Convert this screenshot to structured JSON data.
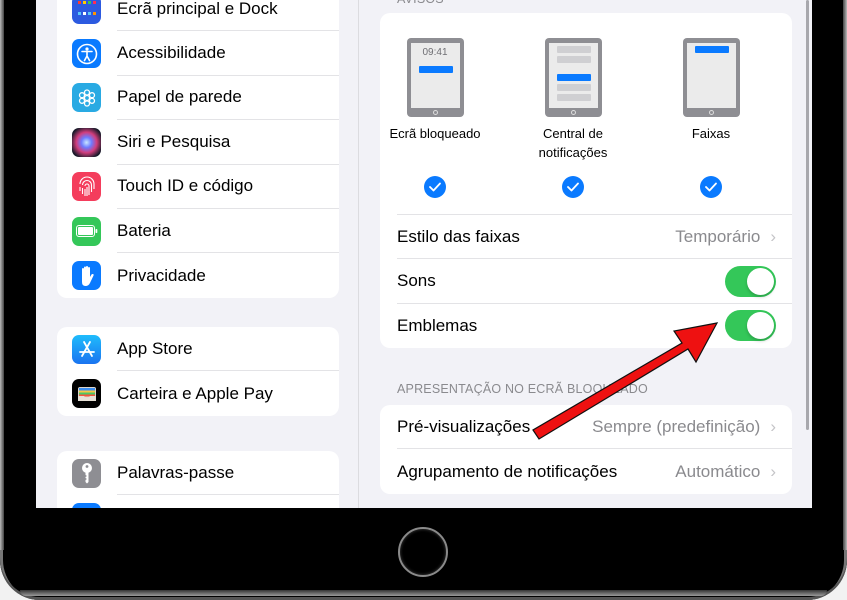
{
  "sidebar": {
    "groups": [
      {
        "items": [
          {
            "label": "Ecrã principal e Dock",
            "icon": "home-screen-icon",
            "color": "#2c5ae0"
          },
          {
            "label": "Acessibilidade",
            "icon": "accessibility-icon",
            "color": "#0a7aff"
          },
          {
            "label": "Papel de parede",
            "icon": "wallpaper-icon",
            "color": "#29aae3"
          },
          {
            "label": "Siri e Pesquisa",
            "icon": "siri-icon",
            "color": "#1c1c2e"
          },
          {
            "label": "Touch ID e código",
            "icon": "fingerprint-icon",
            "color": "#f43d5c"
          },
          {
            "label": "Bateria",
            "icon": "battery-icon",
            "color": "#34c759"
          },
          {
            "label": "Privacidade",
            "icon": "hand-icon",
            "color": "#0a7aff"
          }
        ]
      },
      {
        "items": [
          {
            "label": "App Store",
            "icon": "app-store-icon",
            "color": "#1b8bf5"
          },
          {
            "label": "Carteira e Apple Pay",
            "icon": "wallet-icon",
            "color": "#000000"
          }
        ]
      },
      {
        "items": [
          {
            "label": "Palavras-passe",
            "icon": "key-icon",
            "color": "#8e8e93"
          },
          {
            "label": "",
            "icon": "mail-icon",
            "color": "#0a7aff"
          }
        ]
      }
    ]
  },
  "detail": {
    "alerts_header": "AVISOS",
    "alert_styles": [
      {
        "label": "Ecrã bloqueado",
        "preview_time": "09:41",
        "checked": true
      },
      {
        "label": "Central de notificações",
        "checked": true
      },
      {
        "label": "Faixas",
        "checked": true
      }
    ],
    "banner_style": {
      "label": "Estilo das faixas",
      "value": "Temporário"
    },
    "sounds": {
      "label": "Sons",
      "on": true
    },
    "badges": {
      "label": "Emblemas",
      "on": true
    },
    "lock_screen_header": "APRESENTAÇÃO NO ECRÃ BLOQUEADO",
    "previews": {
      "label": "Pré-visualizações",
      "value": "Sempre (predefinição)"
    },
    "grouping": {
      "label": "Agrupamento de notificações",
      "value": "Automático"
    },
    "chevron": "›"
  },
  "colors": {
    "accent": "#0a7aff",
    "toggle_on": "#34c759",
    "annotation_arrow": "#ee1111"
  }
}
